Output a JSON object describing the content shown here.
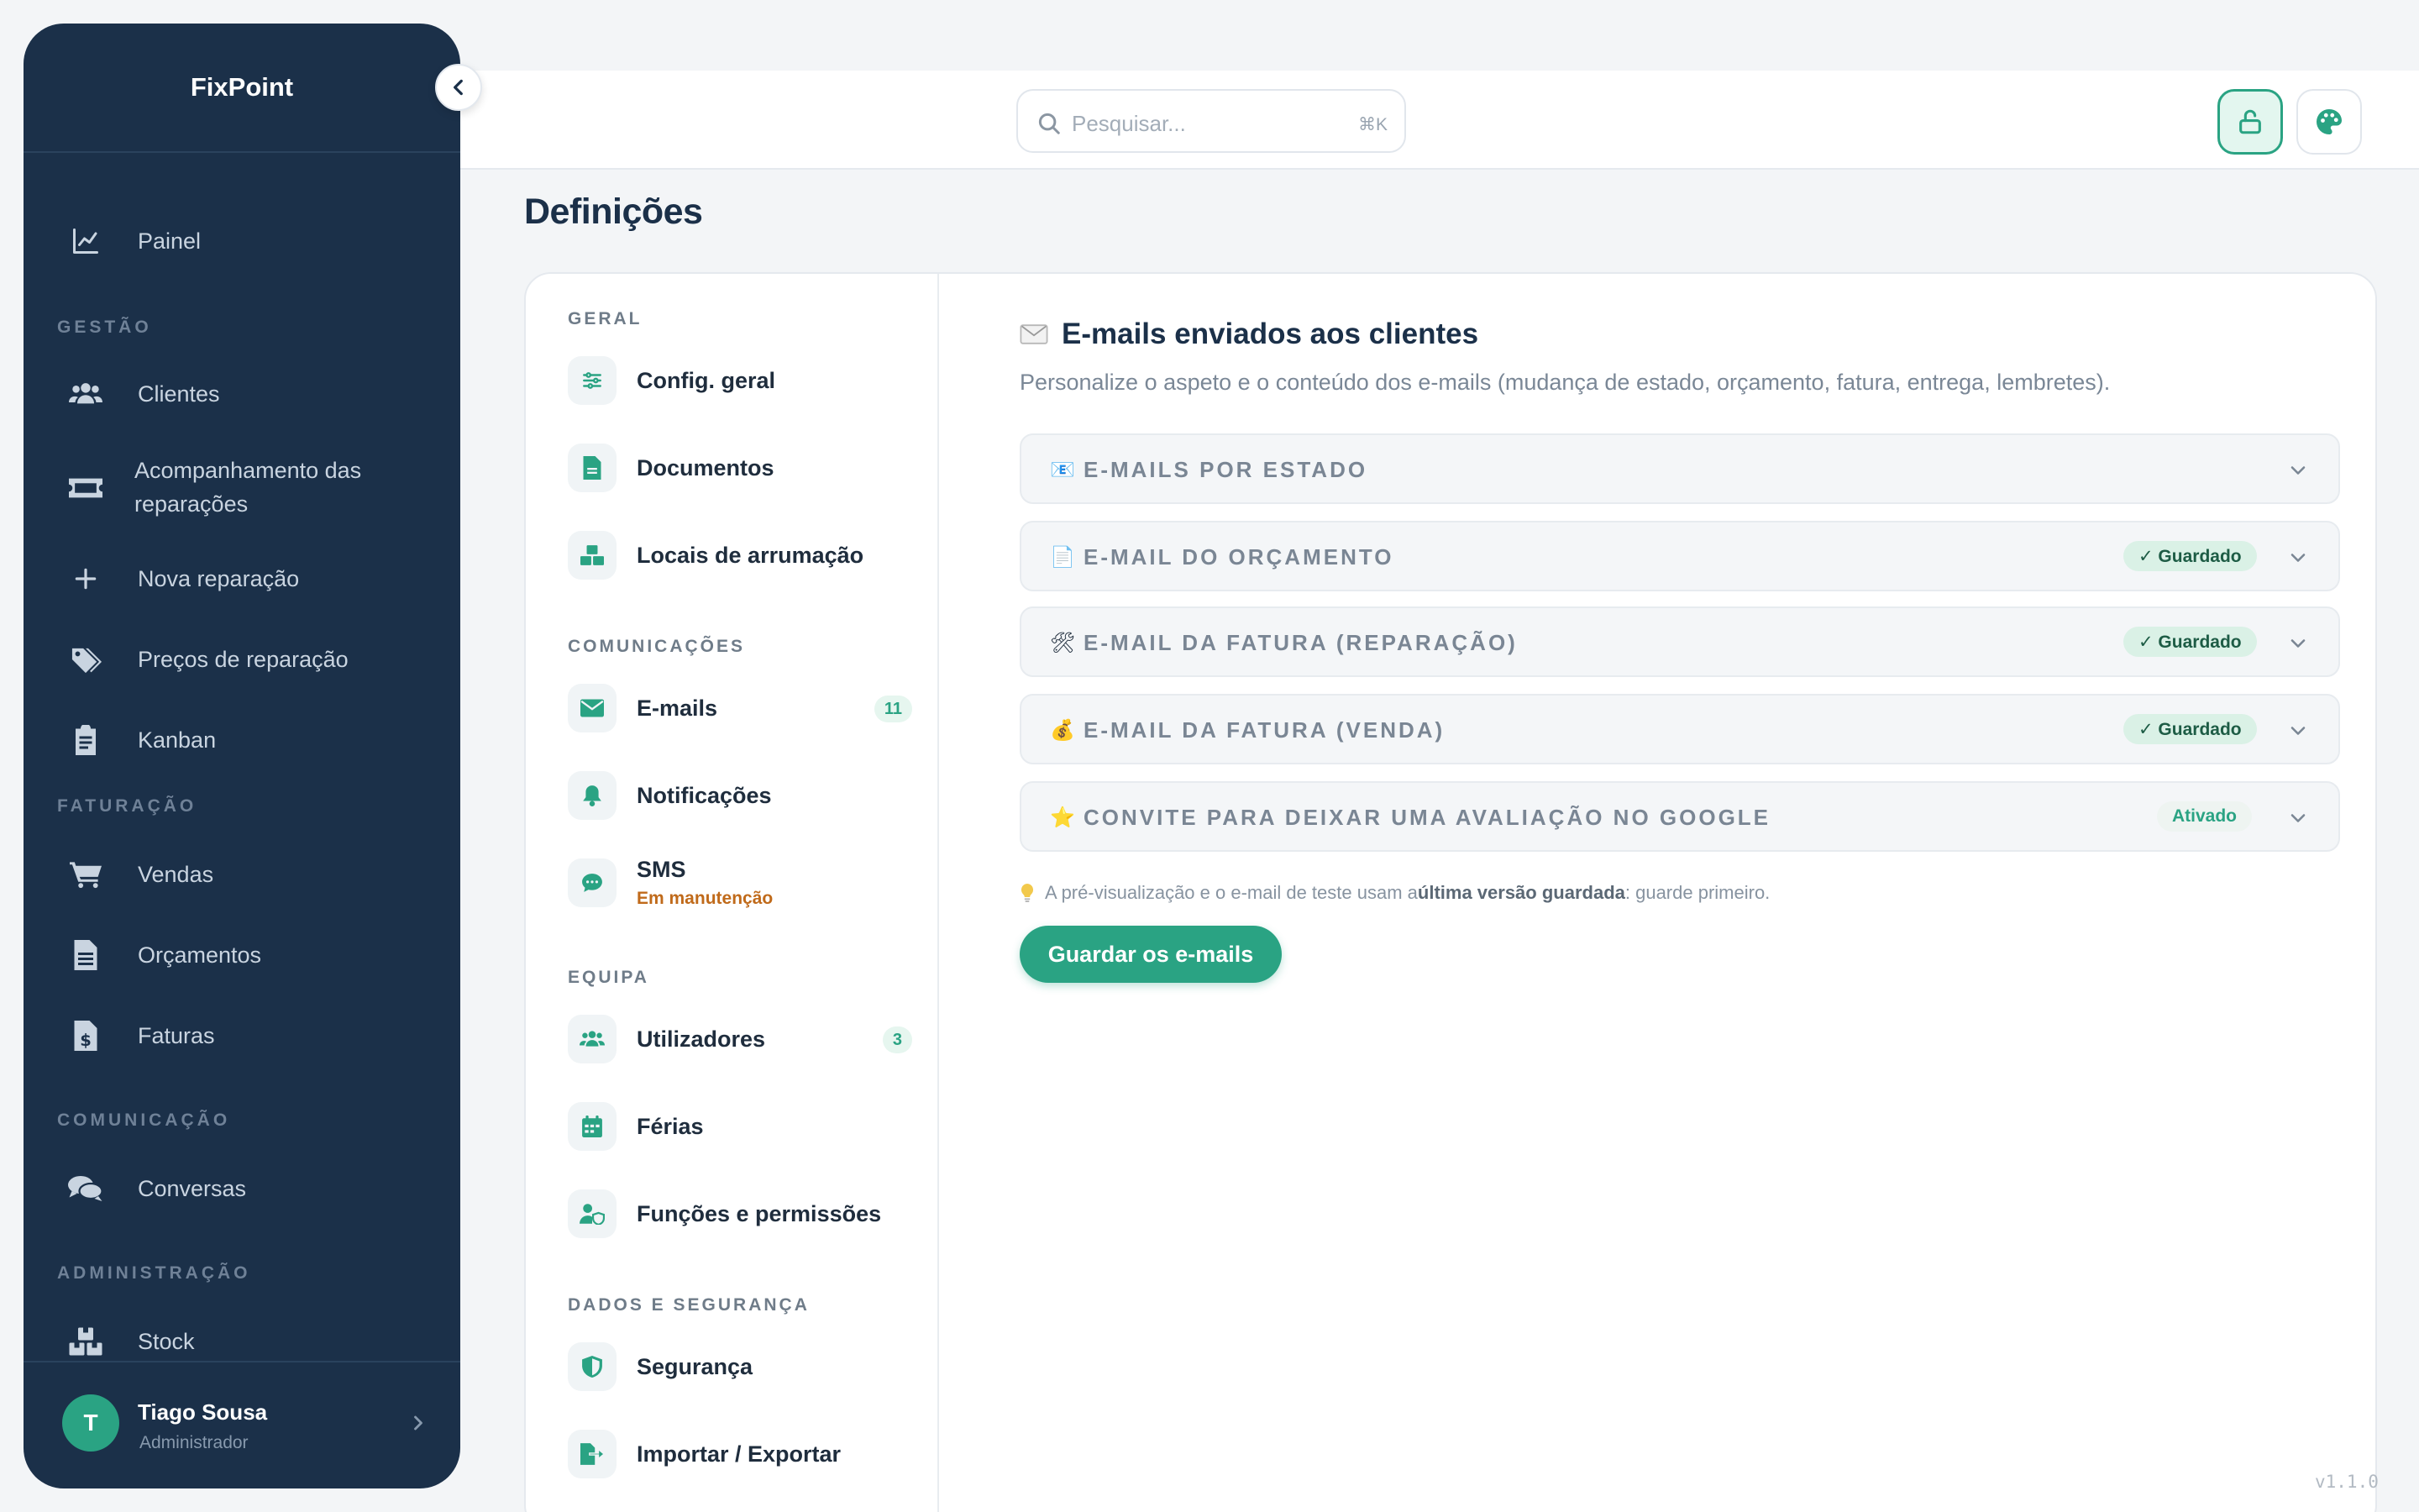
{
  "app": {
    "name": "FixPoint",
    "version": "v1.1.0"
  },
  "sidebar": {
    "top_item": {
      "label": "Painel",
      "icon": "chart-line-icon"
    },
    "sections": [
      {
        "title": "GESTÃO",
        "items": [
          {
            "label": "Clientes",
            "icon": "users-icon"
          },
          {
            "label": "Acompanhamento das reparações",
            "line1": "Acompanhamento das",
            "line2": "reparações",
            "icon": "ticket-icon"
          },
          {
            "label": "Nova reparação",
            "icon": "plus-icon"
          },
          {
            "label": "Preços de reparação",
            "icon": "tags-icon"
          },
          {
            "label": "Kanban",
            "icon": "clipboard-icon"
          }
        ]
      },
      {
        "title": "FATURAÇÃO",
        "items": [
          {
            "label": "Vendas",
            "icon": "cart-icon"
          },
          {
            "label": "Orçamentos",
            "icon": "file-lines-icon"
          },
          {
            "label": "Faturas",
            "icon": "file-invoice-dollar-icon"
          }
        ]
      },
      {
        "title": "COMUNICAÇÃO",
        "items": [
          {
            "label": "Conversas",
            "icon": "comments-icon"
          }
        ]
      },
      {
        "title": "ADMINISTRAÇÃO",
        "items": [
          {
            "label": "Stock",
            "icon": "boxes-icon"
          }
        ]
      }
    ],
    "user": {
      "initial": "T",
      "name": "Tiago Sousa",
      "role": "Administrador"
    }
  },
  "topbar": {
    "search_placeholder": "Pesquisar...",
    "search_shortcut": "⌘K"
  },
  "page": {
    "title": "Definições"
  },
  "settings_nav": {
    "sections": [
      {
        "title": "GERAL",
        "items": [
          {
            "label": "Config. geral",
            "icon": "sliders-icon"
          },
          {
            "label": "Documentos",
            "icon": "document-icon"
          },
          {
            "label": "Locais de arrumação",
            "icon": "boxes-icon"
          }
        ]
      },
      {
        "title": "COMUNICAÇÕES",
        "items": [
          {
            "label": "E-mails",
            "icon": "envelope-icon",
            "badge": "11"
          },
          {
            "label": "Notificações",
            "icon": "bell-icon"
          },
          {
            "label": "SMS",
            "icon": "sms-icon",
            "sublabel": "Em manutenção"
          }
        ]
      },
      {
        "title": "EQUIPA",
        "items": [
          {
            "label": "Utilizadores",
            "icon": "users-icon",
            "badge": "3"
          },
          {
            "label": "Férias",
            "icon": "calendar-icon"
          },
          {
            "label": "Funções e permissões",
            "icon": "user-shield-icon"
          }
        ]
      },
      {
        "title": "DADOS E SEGURANÇA",
        "items": [
          {
            "label": "Segurança",
            "icon": "shield-icon"
          },
          {
            "label": "Importar / Exportar",
            "icon": "file-export-icon"
          }
        ]
      }
    ]
  },
  "content": {
    "title": "E-mails enviados aos clientes",
    "description": "Personalize o aspeto e o conteúdo dos e-mails (mudança de estado, orçamento, fatura, entrega, lembretes).",
    "accordions": [
      {
        "emoji": "📧",
        "label": "E-MAILS POR ESTADO",
        "status": ""
      },
      {
        "emoji": "📄",
        "label": "E-MAIL DO ORÇAMENTO",
        "status": "✓ Guardado"
      },
      {
        "emoji": "🛠",
        "label": "E-MAIL DA FATURA (REPARAÇÃO)",
        "status": "✓ Guardado"
      },
      {
        "emoji": "💰",
        "label": "E-MAIL DA FATURA (VENDA)",
        "status": "✓ Guardado"
      },
      {
        "emoji": "⭐",
        "label": "CONVITE PARA DEIXAR UMA AVALIAÇÃO NO GOOGLE",
        "status": "Ativado"
      }
    ],
    "hint_pre": "A pré-visualização e o e-mail de teste usam a ",
    "hint_bold": "última versão guardada",
    "hint_post": ": guarde primeiro.",
    "save_label": "Guardar os e-mails"
  },
  "colors": {
    "sidebar_bg": "#1b3049",
    "accent": "#2aa383",
    "warning": "#c06a1a"
  }
}
